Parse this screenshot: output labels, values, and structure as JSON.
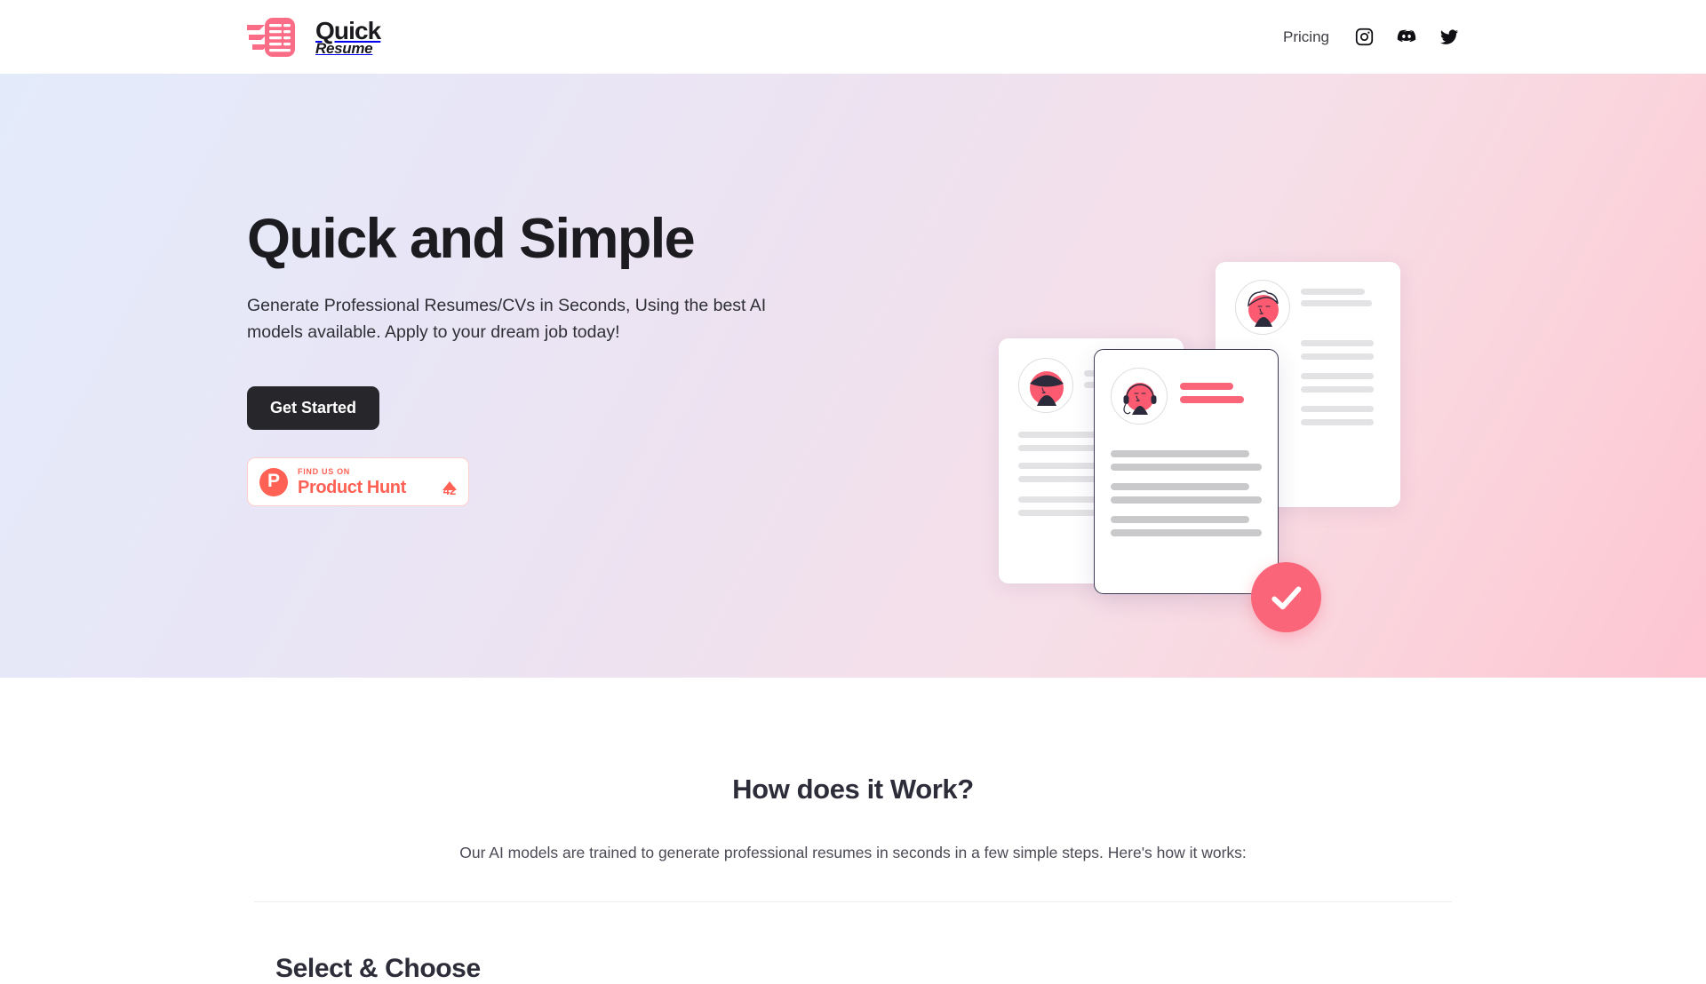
{
  "header": {
    "brand": {
      "line1": "Quick",
      "line2": "Resume",
      "icon": "quick-resume-logo-icon"
    },
    "nav": {
      "pricing": "Pricing"
    },
    "social": [
      {
        "name": "instagram-icon",
        "label": "Instagram"
      },
      {
        "name": "discord-icon",
        "label": "Discord"
      },
      {
        "name": "twitter-icon",
        "label": "Twitter"
      }
    ]
  },
  "hero": {
    "title": "Quick and Simple",
    "subtitle": "Generate Professional Resumes/CVs in Seconds, Using the best AI models available. Apply to your dream job today!",
    "cta_label": "Get Started",
    "product_hunt": {
      "eyebrow": "FIND US ON",
      "name": "Product Hunt",
      "votes": "42",
      "logo_letter": "P"
    }
  },
  "works": {
    "title": "How does it Work?",
    "subtitle": "Our AI models are trained to generate professional resumes in seconds in a few simple steps. Here's how it works:",
    "step_title": "Select & Choose"
  },
  "colors": {
    "brand_pink": "#fb6579",
    "product_hunt": "#ff6154",
    "button_dark": "#27262b",
    "gradient_start": "#e3ebfb",
    "gradient_end": "#fdc5d1"
  }
}
